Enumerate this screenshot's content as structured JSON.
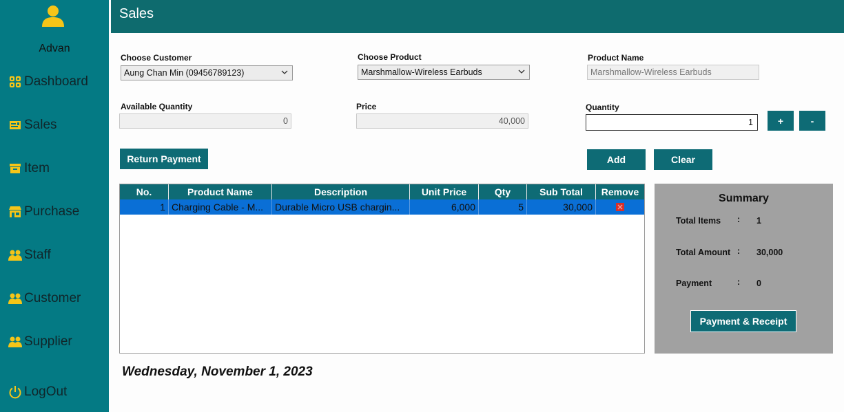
{
  "user": {
    "name": "Advan"
  },
  "nav": [
    {
      "label": "Dashboard",
      "icon": "dashboard-icon"
    },
    {
      "label": "Sales",
      "icon": "sales-icon"
    },
    {
      "label": "Item",
      "icon": "item-icon"
    },
    {
      "label": "Purchase",
      "icon": "purchase-icon"
    },
    {
      "label": "Staff",
      "icon": "staff-icon"
    },
    {
      "label": "Customer",
      "icon": "customer-icon"
    },
    {
      "label": "Supplier",
      "icon": "supplier-icon"
    },
    {
      "label": "LogOut",
      "icon": "power-icon"
    }
  ],
  "header": {
    "title": "Sales"
  },
  "form": {
    "customer_label": "Choose Customer",
    "customer_value": "Aung Chan Min  (09456789123)",
    "product_label": "Choose Product",
    "product_value": "Marshmallow-Wireless Earbuds",
    "product_name_label": "Product Name",
    "product_name_value": "Marshmallow-Wireless Earbuds",
    "available_label": "Available Quantity",
    "available_value": "0",
    "price_label": "Price",
    "price_value": "40,000",
    "quantity_label": "Quantity",
    "quantity_value": "1"
  },
  "buttons": {
    "plus": "+",
    "minus": "-",
    "return_payment": "Return Payment",
    "add": "Add",
    "clear": "Clear",
    "payment_receipt": "Payment & Receipt"
  },
  "table": {
    "columns": [
      "No.",
      "Product Name",
      "Description",
      "Unit Price",
      "Qty",
      "Sub Total",
      "Remove"
    ],
    "rows": [
      {
        "no": "1",
        "product": "Charging Cable - M...",
        "description": "Durable Micro USB chargin...",
        "unit_price": "6,000",
        "qty": "5",
        "sub_total": "30,000"
      }
    ]
  },
  "summary": {
    "title": "Summary",
    "total_items_label": "Total Items",
    "total_items_value": "1",
    "total_amount_label": "Total Amount",
    "total_amount_value": "30,000",
    "payment_label": "Payment",
    "payment_value": "0",
    "colon": ":"
  },
  "date": "Wednesday, November 1, 2023",
  "colors": {
    "sidebar": "#047a84",
    "header": "#0e6b6e",
    "button": "#0e6b75",
    "icon_yellow": "#f5c518",
    "selected_row": "#0a6fd6",
    "remove": "#d9302c"
  }
}
